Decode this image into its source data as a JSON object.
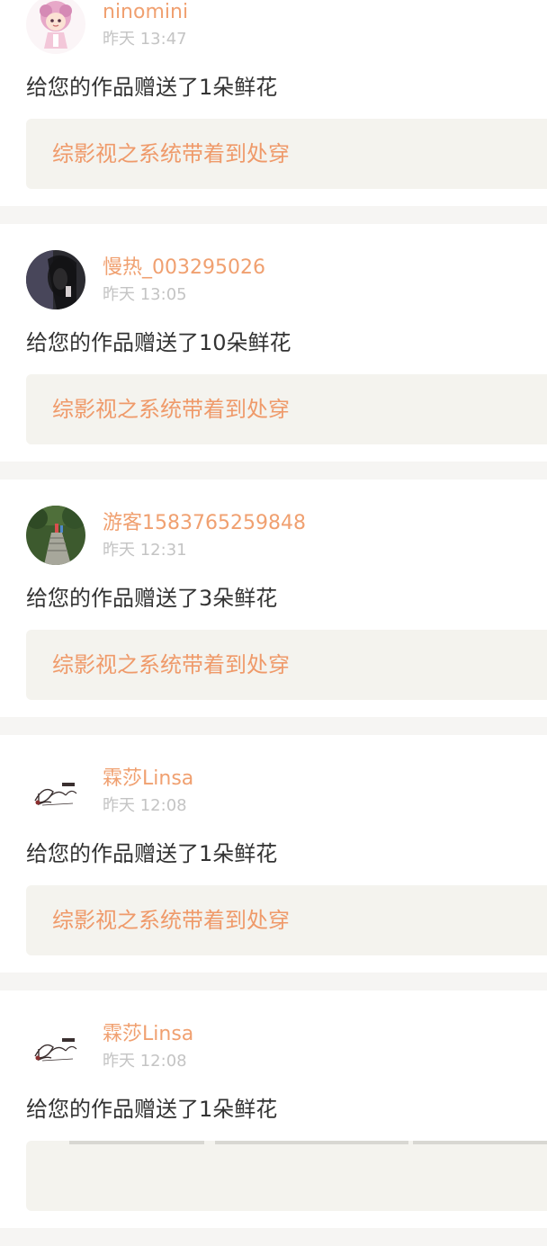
{
  "notifications": [
    {
      "username": "ninomini",
      "time": "昨天 13:47",
      "message": "给您的作品赠送了1朵鲜花",
      "work_title": "综影视之系统带着到处穿",
      "avatar_icon": "cartoon-girl-avatar-icon"
    },
    {
      "username": "慢热_003295026",
      "time": "昨天 13:05",
      "message": "给您的作品赠送了10朵鲜花",
      "work_title": "综影视之系统带着到处穿",
      "avatar_icon": "dark-portrait-avatar-icon"
    },
    {
      "username": "游客1583765259848",
      "time": "昨天 12:31",
      "message": "给您的作品赠送了3朵鲜花",
      "work_title": "综影视之系统带着到处穿",
      "avatar_icon": "forest-stairs-avatar-icon"
    },
    {
      "username": "霖莎Linsa",
      "time": "昨天 12:08",
      "message": "给您的作品赠送了1朵鲜花",
      "work_title": "综影视之系统带着到处穿",
      "avatar_icon": "linsa-logo-avatar-icon"
    },
    {
      "username": "霖莎Linsa",
      "time": "昨天 12:08",
      "message": "给您的作品赠送了1朵鲜花",
      "work_title": "",
      "avatar_icon": "linsa-logo-avatar-icon"
    }
  ],
  "colors": {
    "username": "#f0a070",
    "time": "#c4c4c4",
    "message": "#333333",
    "work_title": "#ef9a6a",
    "work_background": "#f4f3ee",
    "separator": "#f6f5f3"
  }
}
